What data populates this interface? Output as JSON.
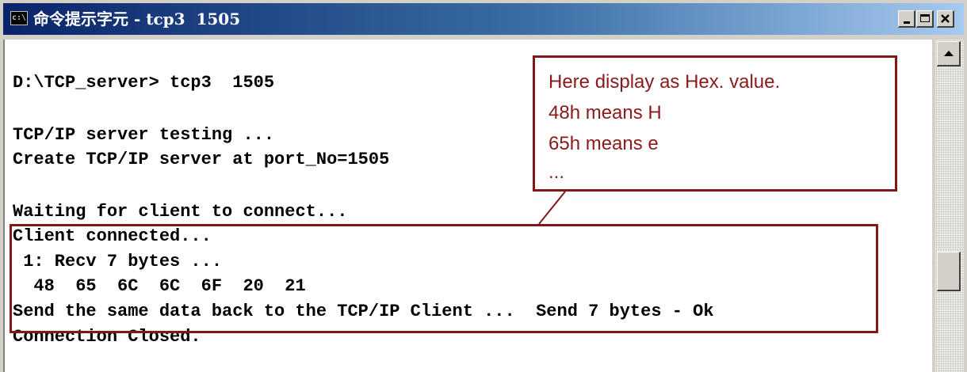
{
  "window": {
    "icon_text": "c:\\",
    "title": "命令提示字元 - tcp3  1505"
  },
  "console": {
    "lines": [
      "D:\\TCP_server> tcp3  1505",
      "TCP/IP server testing ...",
      "Create TCP/IP server at port_No=1505",
      "Waiting for client to connect...",
      "Client connected...",
      " 1: Recv 7 bytes ...",
      "  48  65  6C  6C  6F  20  21",
      "Send the same data back to the TCP/IP Client ...  Send 7 bytes - Ok",
      "Connection Closed."
    ]
  },
  "annotation": {
    "lines": [
      "Here display as Hex. value.",
      "48h means H",
      "65h means e",
      "..."
    ],
    "color": "#8b1a1a",
    "border_color": "#7f1818"
  },
  "controls": {
    "minimize": "minimize",
    "maximize": "maximize",
    "close": "close"
  }
}
